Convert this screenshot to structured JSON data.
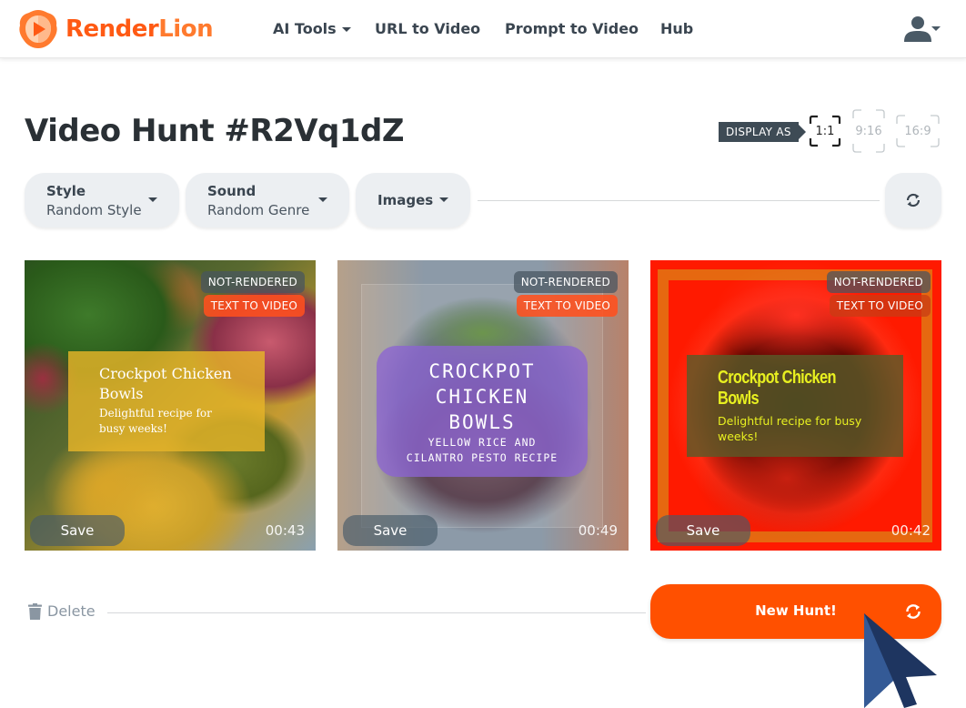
{
  "brand": {
    "name_part1": "Render",
    "name_part2": "Lion",
    "accent": "#ff5000"
  },
  "nav": {
    "items": [
      {
        "label": "AI Tools",
        "has_caret": true
      },
      {
        "label": "URL to Video"
      },
      {
        "label": "Prompt to Video"
      },
      {
        "label": "Hub"
      }
    ],
    "user_icon": "user-icon"
  },
  "page": {
    "title": "Video Hunt #R2Vq1dZ",
    "display_as_label": "DISPLAY AS",
    "ratios": [
      {
        "label": "1:1",
        "selected": true
      },
      {
        "label": "9:16",
        "selected": false
      },
      {
        "label": "16:9",
        "selected": false
      }
    ]
  },
  "filters": {
    "style": {
      "label": "Style",
      "value": "Random Style"
    },
    "sound": {
      "label": "Sound",
      "value": "Random Genre"
    },
    "images": {
      "label": "Images"
    },
    "refresh_icon": "refresh-icon"
  },
  "cards": [
    {
      "status": "NOT-RENDERED",
      "type": "TEXT TO VIDEO",
      "headline": "Crockpot Chicken Bowls",
      "subline": "Delightful recipe for busy weeks!",
      "save_label": "Save",
      "duration": "00:43"
    },
    {
      "status": "NOT-RENDERED",
      "type": "TEXT TO VIDEO",
      "headline_lines": [
        "CROCKPOT",
        "CHICKEN",
        "BOWLS"
      ],
      "subline_lines": [
        "YELLOW RICE AND",
        "CILANTRO PESTO RECIPE"
      ],
      "save_label": "Save",
      "duration": "00:49"
    },
    {
      "status": "NOT-RENDERED",
      "type": "TEXT TO VIDEO",
      "headline": "Crockpot Chicken Bowls",
      "subline": "Delightful recipe for busy weeks!",
      "save_label": "Save",
      "duration": "00:42"
    }
  ],
  "footer": {
    "delete_label": "Delete",
    "new_hunt_label": "New Hunt!"
  }
}
